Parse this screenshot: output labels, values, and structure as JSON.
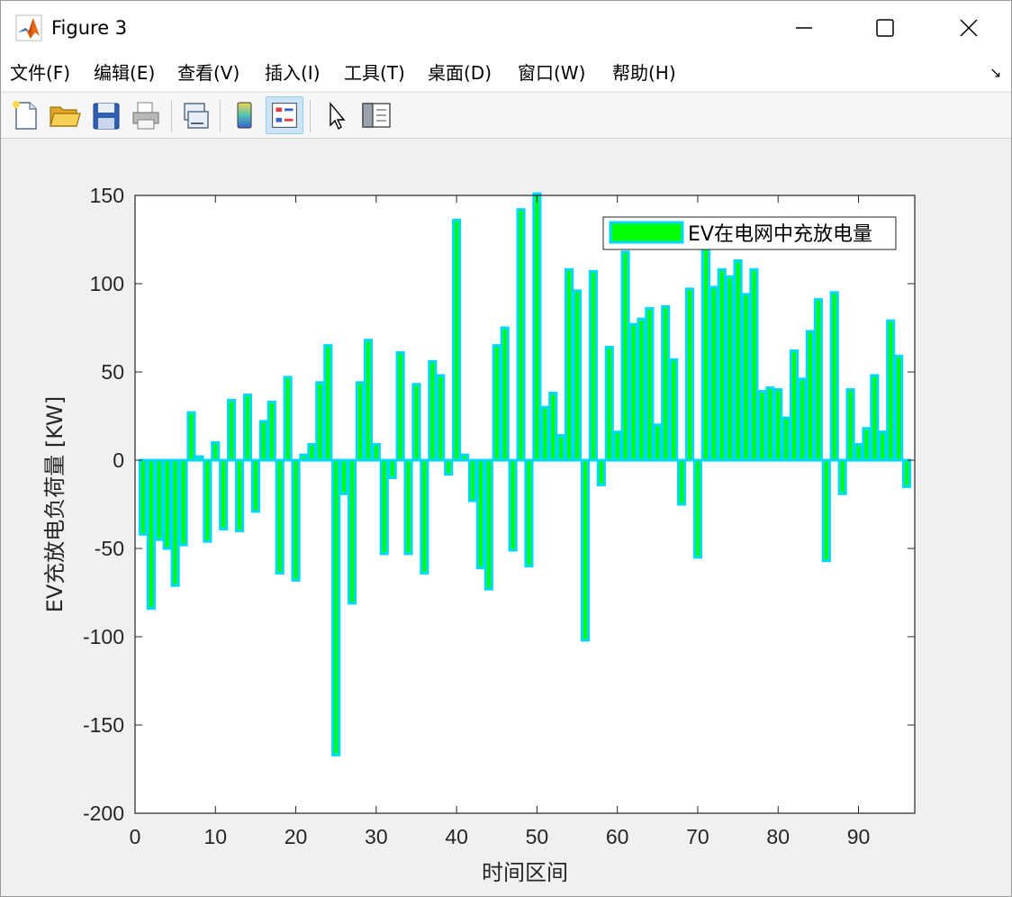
{
  "window": {
    "title": "Figure 3"
  },
  "menu": [
    {
      "label": "文件(F)",
      "name": "menu-file"
    },
    {
      "label": "编辑(E)",
      "name": "menu-edit"
    },
    {
      "label": "查看(V)",
      "name": "menu-view"
    },
    {
      "label": "插入(I)",
      "name": "menu-insert"
    },
    {
      "label": "工具(T)",
      "name": "menu-tools"
    },
    {
      "label": "桌面(D)",
      "name": "menu-desktop"
    },
    {
      "label": "窗口(W)",
      "name": "menu-window"
    },
    {
      "label": "帮助(H)",
      "name": "menu-help"
    }
  ],
  "menu_arrow": "↘",
  "toolbar": [
    {
      "icon": "new-figure-icon"
    },
    {
      "icon": "open-file-icon"
    },
    {
      "icon": "save-icon"
    },
    {
      "icon": "print-icon"
    },
    {
      "icon": "link-figure-icon"
    },
    {
      "icon": "insert-colorbar-icon"
    },
    {
      "icon": "insert-legend-icon",
      "active": true
    },
    {
      "icon": "edit-plot-arrow-icon"
    },
    {
      "icon": "property-inspector-icon"
    }
  ],
  "colors": {
    "bar_face": "#00ff00",
    "bar_edge": "#00d8ff",
    "axis": "#262626",
    "background": "#f0f0f0"
  },
  "chart_data": {
    "type": "bar",
    "xlabel": "时间区间",
    "ylabel": "EV充放电负荷量 [KW]",
    "xlim": [
      0,
      97
    ],
    "ylim": [
      -200,
      150
    ],
    "xticks": [
      0,
      10,
      20,
      30,
      40,
      50,
      60,
      70,
      80,
      90
    ],
    "yticks": [
      -200,
      -150,
      -100,
      -50,
      0,
      50,
      100,
      150
    ],
    "grid": false,
    "legend": {
      "position": "top-right",
      "entries": [
        "EV在电网中充放电量"
      ]
    },
    "series": [
      {
        "name": "EV在电网中充放电量",
        "x": [
          1,
          2,
          3,
          4,
          5,
          6,
          7,
          8,
          9,
          10,
          11,
          12,
          13,
          14,
          15,
          16,
          17,
          18,
          19,
          20,
          21,
          22,
          23,
          24,
          25,
          26,
          27,
          28,
          29,
          30,
          31,
          32,
          33,
          34,
          35,
          36,
          37,
          38,
          39,
          40,
          41,
          42,
          43,
          44,
          45,
          46,
          47,
          48,
          49,
          50,
          51,
          52,
          53,
          54,
          55,
          56,
          57,
          58,
          59,
          60,
          61,
          62,
          63,
          64,
          65,
          66,
          67,
          68,
          69,
          70,
          71,
          72,
          73,
          74,
          75,
          76,
          77,
          78,
          79,
          80,
          81,
          82,
          83,
          84,
          85,
          86,
          87,
          88,
          89,
          90,
          91,
          92,
          93,
          94,
          95,
          96
        ],
        "values": [
          -42,
          -84,
          -45,
          -50,
          -71,
          -48,
          27,
          2,
          -46,
          10,
          -39,
          34,
          -40,
          37,
          -29,
          22,
          33,
          -64,
          47,
          -68,
          3,
          9,
          44,
          65,
          -167,
          -19,
          -81,
          44,
          68,
          9,
          -53,
          -10,
          61,
          -53,
          43,
          -64,
          56,
          48,
          -8,
          136,
          3,
          -23,
          -61,
          -73,
          65,
          75,
          -51,
          142,
          -60,
          151,
          30,
          38,
          14,
          108,
          96,
          -102,
          107,
          -14,
          64,
          16,
          118,
          77,
          80,
          86,
          20,
          87,
          57,
          -25,
          97,
          -55,
          121,
          98,
          108,
          104,
          113,
          94,
          108,
          39,
          41,
          40,
          24,
          62,
          46,
          73,
          91,
          -57,
          95,
          -19,
          40,
          9,
          18,
          48,
          16,
          79,
          59,
          -15
        ]
      }
    ]
  }
}
